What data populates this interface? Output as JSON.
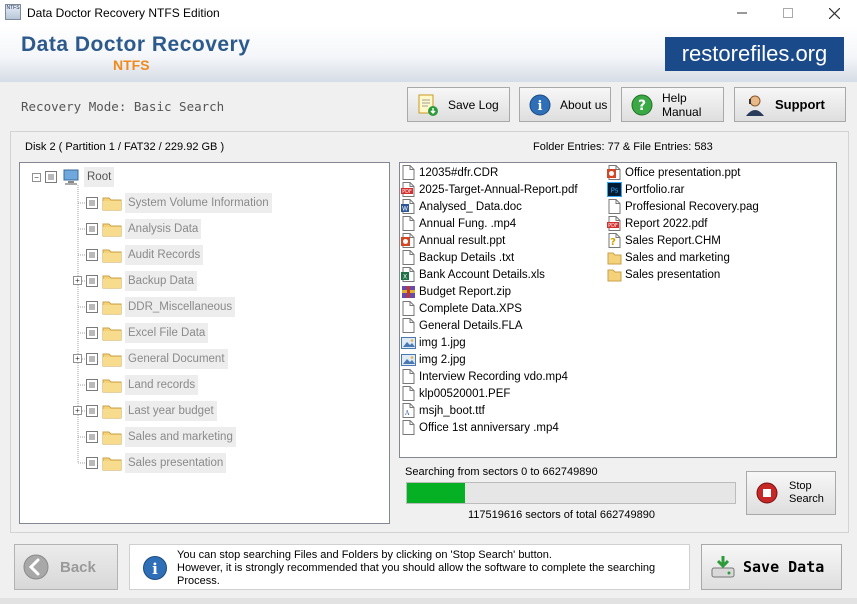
{
  "window": {
    "title": "Data Doctor Recovery NTFS Edition",
    "icon_text": "NTFS"
  },
  "banner": {
    "brand": "Data Doctor Recovery",
    "edition": "NTFS",
    "site": "restorefiles.org"
  },
  "mode_text": "Recovery Mode: Basic Search",
  "toolbar": {
    "save_log": "Save Log",
    "about_us": "About us",
    "help_manual": "Help Manual",
    "support": "Support"
  },
  "disk_info": "Disk 2 ( Partition 1 / FAT32 / 229.92 GB )",
  "entries_info": "Folder Entries: 77 & File Entries: 583",
  "tree": {
    "root": "Root",
    "folders": [
      {
        "label": "System Volume Information",
        "expandable": false
      },
      {
        "label": "Analysis Data",
        "expandable": false
      },
      {
        "label": "Audit Records",
        "expandable": false
      },
      {
        "label": "Backup Data",
        "expandable": true
      },
      {
        "label": "DDR_Miscellaneous",
        "expandable": false
      },
      {
        "label": "Excel File Data",
        "expandable": false
      },
      {
        "label": "General Document",
        "expandable": true
      },
      {
        "label": "Land records",
        "expandable": false
      },
      {
        "label": "Last year budget",
        "expandable": true
      },
      {
        "label": "Sales and marketing",
        "expandable": false
      },
      {
        "label": "Sales presentation",
        "expandable": false
      }
    ]
  },
  "files_col1": [
    {
      "name": "12035#dfr.CDR",
      "icon": "file-icon"
    },
    {
      "name": "2025-Target-Annual-Report.pdf",
      "icon": "pdf-icon"
    },
    {
      "name": "Analysed_ Data.doc",
      "icon": "doc-icon"
    },
    {
      "name": "Annual Fung. .mp4",
      "icon": "file-icon"
    },
    {
      "name": "Annual result.ppt",
      "icon": "ppt-icon"
    },
    {
      "name": "Backup Details .txt",
      "icon": "file-icon"
    },
    {
      "name": "Bank Account Details.xls",
      "icon": "xls-icon"
    },
    {
      "name": "Budget Report.zip",
      "icon": "zip-icon"
    },
    {
      "name": "Complete Data.XPS",
      "icon": "file-icon"
    },
    {
      "name": "General Details.FLA",
      "icon": "file-icon"
    },
    {
      "name": "img 1.jpg",
      "icon": "image-icon"
    },
    {
      "name": "img 2.jpg",
      "icon": "image-icon"
    },
    {
      "name": "Interview Recording vdo.mp4",
      "icon": "file-icon"
    },
    {
      "name": "klp00520001.PEF",
      "icon": "file-icon"
    },
    {
      "name": "msjh_boot.ttf",
      "icon": "font-icon"
    },
    {
      "name": "Office 1st anniversary .mp4",
      "icon": "file-icon"
    }
  ],
  "files_col2": [
    {
      "name": "Office presentation.ppt",
      "icon": "ppt-icon"
    },
    {
      "name": "Portfolio.rar",
      "icon": "psd-icon"
    },
    {
      "name": "Proffesional Recovery.pag",
      "icon": "file-icon"
    },
    {
      "name": "Report 2022.pdf",
      "icon": "pdf-icon"
    },
    {
      "name": "Sales Report.CHM",
      "icon": "chm-icon"
    },
    {
      "name": "Sales and marketing",
      "icon": "folder-icon"
    },
    {
      "name": "Sales presentation",
      "icon": "folder-icon"
    }
  ],
  "progress": {
    "range_text": "Searching from sectors    0 to 662749890",
    "count_text": "117519616   sectors  of  total 662749890",
    "fraction": 0.1773,
    "stop_label_1": "Stop",
    "stop_label_2": "Search"
  },
  "bottom": {
    "back": "Back",
    "info_line1": "You can stop searching Files and Folders by clicking on 'Stop Search' button.",
    "info_line2": "However, it is strongly recommended that you should allow the software to complete the searching",
    "info_line3": "Process.",
    "save": "Save Data"
  },
  "colors": {
    "brand_blue": "#2d5a8c",
    "edition_orange": "#f08a1c",
    "site_bg": "#1a4a8a",
    "progress_green": "#06b025"
  }
}
